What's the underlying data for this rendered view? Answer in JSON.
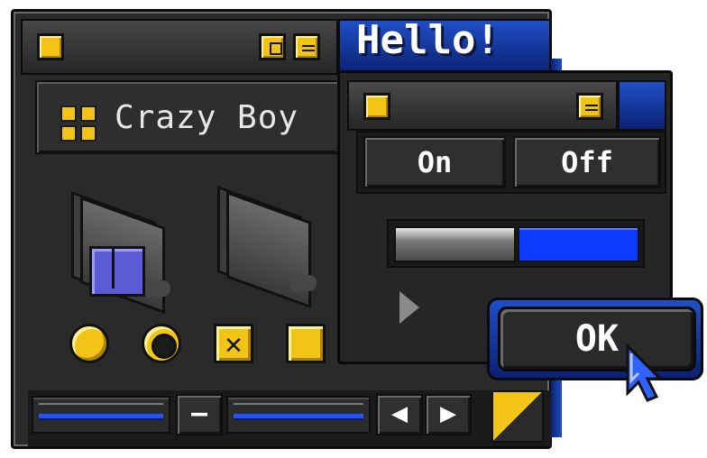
{
  "main_window": {
    "banner": "Hello!",
    "app_name": "Crazy Boy",
    "controls": {
      "close": "close-icon",
      "maximize": "maximize-icon",
      "minimize": "minimize-icon"
    },
    "icons": [
      {
        "name": "finder-folder-icon"
      },
      {
        "name": "empty-folder-icon"
      }
    ],
    "widgets": [
      {
        "name": "radio-selected"
      },
      {
        "name": "radio-unselected"
      },
      {
        "name": "checkbox-checked",
        "glyph": "✕"
      },
      {
        "name": "checkbox-unchecked"
      }
    ],
    "bottom": {
      "minus_label": "–",
      "left_label": "◀",
      "right_label": "▶"
    }
  },
  "dialog": {
    "segmented": {
      "on_label": "On",
      "off_label": "Off"
    },
    "slider": {
      "value": 0.5
    },
    "ok_label": "OK"
  },
  "colors": {
    "accent": "#f3c416",
    "blue": "#1f4fc7",
    "dark": "#2a2a2a"
  }
}
